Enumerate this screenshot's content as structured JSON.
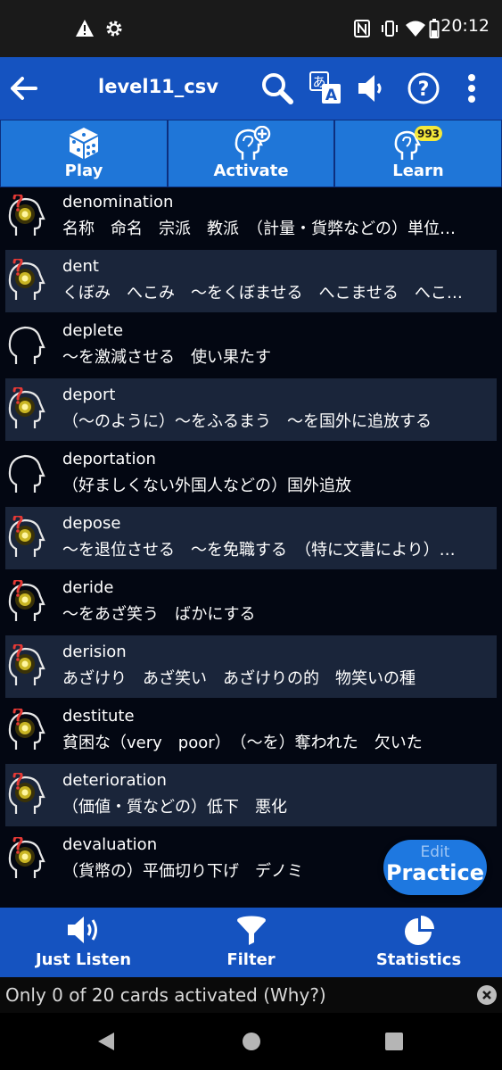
{
  "status_bar": {
    "time": "20:12"
  },
  "app_bar": {
    "title": "level11_csv"
  },
  "modes": [
    {
      "label": "Play"
    },
    {
      "label": "Activate"
    },
    {
      "label": "Learn",
      "badge": "993"
    }
  ],
  "cards": [
    {
      "word": "denomination",
      "meaning": "名称　命名　宗派　教派　（計量・貨弊などの）単位…",
      "state": "active"
    },
    {
      "word": "dent",
      "meaning": "くぼみ　へこみ　～をくぼませる　へこませる　へこ…",
      "state": "active"
    },
    {
      "word": "deplete",
      "meaning": "～を激減させる　使い果たす",
      "state": "inactive"
    },
    {
      "word": "deport",
      "meaning": "（～のように）～をふるまう　～を国外に追放する",
      "state": "active"
    },
    {
      "word": "deportation",
      "meaning": "（好ましくない外国人などの）国外追放",
      "state": "inactive"
    },
    {
      "word": "depose",
      "meaning": "～を退位させる　～を免職する　（特に文書により）…",
      "state": "active"
    },
    {
      "word": "deride",
      "meaning": "～をあざ笑う　ばかにする",
      "state": "active"
    },
    {
      "word": "derision",
      "meaning": "あざけり　あざ笑い　あざけりの的　物笑いの種",
      "state": "active"
    },
    {
      "word": "destitute",
      "meaning": "貧困な（very　poor）　（～を）奪われた　欠いた",
      "state": "active"
    },
    {
      "word": "deterioration",
      "meaning": "（価値・質などの）低下　悪化",
      "state": "active"
    },
    {
      "word": "devaluation",
      "meaning": "（貨幣の）平価切り下げ　デノミ",
      "state": "active"
    }
  ],
  "practice_button": {
    "edit_label": "Edit",
    "main_label": "Practice"
  },
  "bottom_bar": [
    {
      "label": "Just Listen"
    },
    {
      "label": "Filter"
    },
    {
      "label": "Statistics"
    }
  ],
  "notice": {
    "text": "Only 0 of 20 cards activated (Why?)"
  },
  "colors": {
    "app_bar": "#1553c0",
    "mode_button": "#1f76d8",
    "badge": "#f4e83a",
    "list_bg": "#030712",
    "alt_row": "#1a253a"
  }
}
